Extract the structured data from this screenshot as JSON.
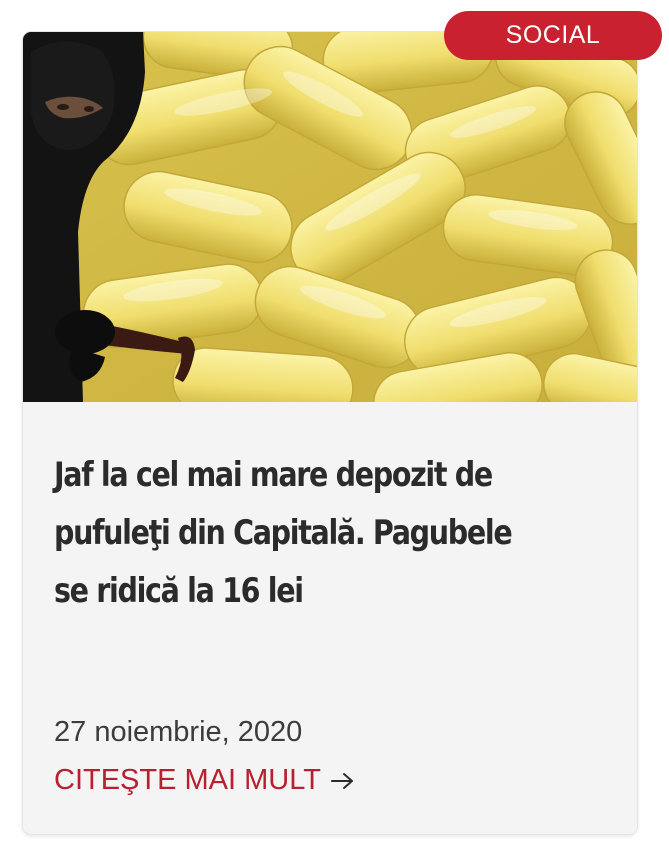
{
  "article": {
    "category": "SOCIAL",
    "headline_lines": [
      "Jaf la cel mai mare depozit de",
      "pufuleţi din Capitală. Pagubele",
      "se ridică la 16 lei"
    ],
    "date": "27 noiembrie, 2020",
    "read_more_label": "CITEŞTE MAI MULT",
    "read_more_icon": "arrow-right-icon",
    "image_subject": "burglar-with-crowbar-over-pile-of-corn-puffs"
  },
  "colors": {
    "accent": "#c9212f",
    "link": "#b7212f",
    "headline": "#2b2b2b",
    "content_bg": "#f4f4f4"
  }
}
